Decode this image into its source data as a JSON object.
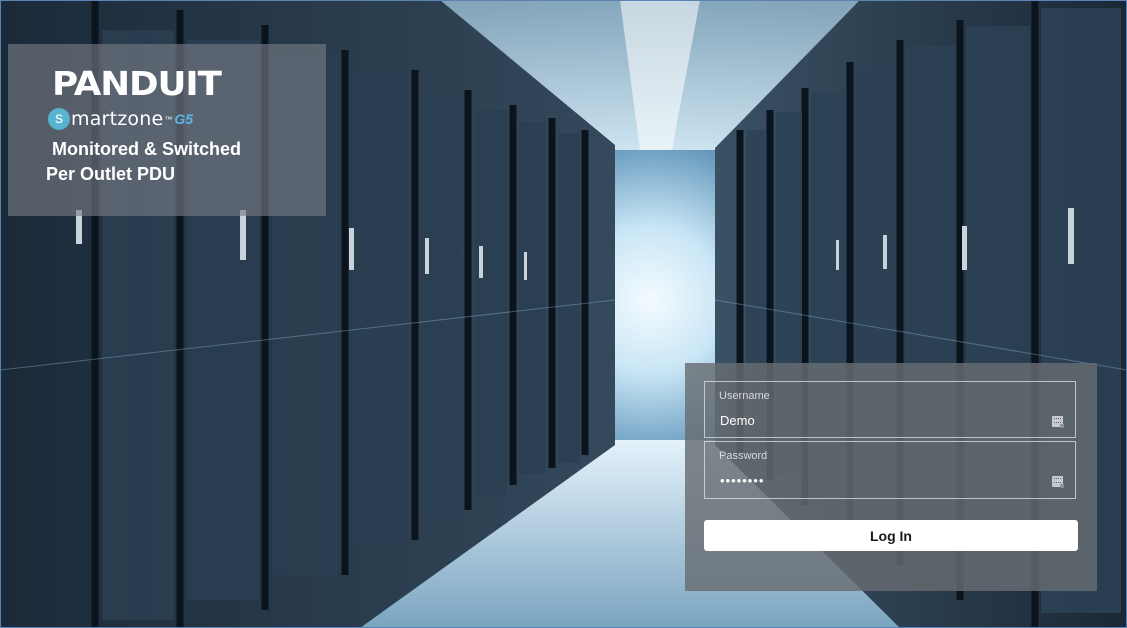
{
  "brand": {
    "company": "PANDUIT",
    "product_s": "s",
    "product_rest": "martzone",
    "product_tm": "™",
    "product_gen": "G5",
    "subtitle_line1": "Monitored & Switched",
    "subtitle_line2": "Per Outlet PDU"
  },
  "login": {
    "username_label": "Username",
    "username_value": "Demo",
    "password_label": "Password",
    "password_value": "demodemo",
    "submit_label": "Log In",
    "field_icon": "keyboard-key-icon"
  },
  "colors": {
    "panel_gray": "#787d84",
    "accent_blue": "#56b4d0",
    "button_white": "#ffffff"
  },
  "background": {
    "scene": "server-room-aisle"
  }
}
